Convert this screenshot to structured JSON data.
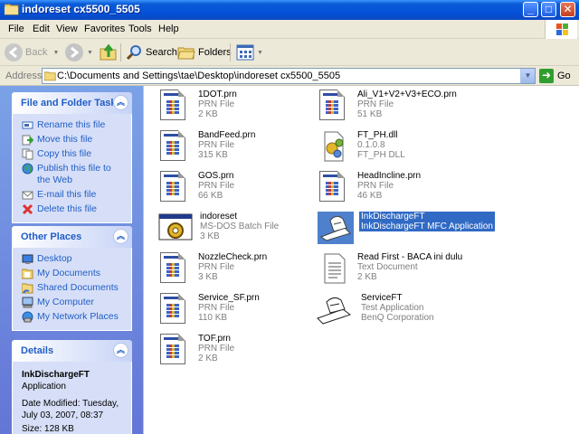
{
  "window": {
    "title": "indoreset cx5500_5505"
  },
  "menu": [
    "File",
    "Edit",
    "View",
    "Favorites",
    "Tools",
    "Help"
  ],
  "toolbar": {
    "back": "Back",
    "search": "Search",
    "folders": "Folders"
  },
  "address": {
    "label": "Address",
    "path": "C:\\Documents and Settings\\tae\\Desktop\\indoreset cx5500_5505",
    "go": "Go"
  },
  "tasks": {
    "file_folder": {
      "title": "File and Folder Tasks",
      "items": [
        "Rename this file",
        "Move this file",
        "Copy this file",
        "Publish this file to the Web",
        "E-mail this file",
        "Delete this file"
      ]
    },
    "other_places": {
      "title": "Other Places",
      "items": [
        "Desktop",
        "My Documents",
        "Shared Documents",
        "My Computer",
        "My Network Places"
      ]
    },
    "details": {
      "title": "Details",
      "name": "InkDischargeFT",
      "type": "Application",
      "modified": "Date Modified: Tuesday, July 03, 2007, 08:37",
      "size": "Size: 128 KB"
    }
  },
  "files": [
    {
      "name": "1DOT.prn",
      "line2": "PRN File",
      "line3": "2 KB",
      "icon": "prn-file-icon"
    },
    {
      "name": "Ali_V1+V2+V3+ECO.prn",
      "line2": "PRN File",
      "line3": "51 KB",
      "icon": "prn-file-icon"
    },
    {
      "name": "BandFeed.prn",
      "line2": "PRN File",
      "line3": "315 KB",
      "icon": "prn-file-icon"
    },
    {
      "name": "FT_PH.dll",
      "line2": "0.1.0.8",
      "line3": "FT_PH DLL",
      "icon": "dll-file-icon"
    },
    {
      "name": "GOS.prn",
      "line2": "PRN File",
      "line3": "66 KB",
      "icon": "prn-file-icon"
    },
    {
      "name": "HeadIncline.prn",
      "line2": "PRN File",
      "line3": "46 KB",
      "icon": "prn-file-icon"
    },
    {
      "name": "indoreset",
      "line2": "MS-DOS Batch File",
      "line3": "3 KB",
      "icon": "batch-file-icon"
    },
    {
      "name": "InkDischargeFT",
      "line2": "InkDischargeFT MFC Application",
      "line3": "",
      "icon": "ink-app-icon",
      "selected": true
    },
    {
      "name": "NozzleCheck.prn",
      "line2": "PRN File",
      "line3": "3 KB",
      "icon": "prn-file-icon"
    },
    {
      "name": "Read First - BACA ini dulu",
      "line2": "Text Document",
      "line3": "2 KB",
      "icon": "text-file-icon"
    },
    {
      "name": "Service_SF.prn",
      "line2": "PRN File",
      "line3": "110 KB",
      "icon": "prn-file-icon"
    },
    {
      "name": "ServiceFT",
      "line2": "Test Application",
      "line3": "BenQ Corporation",
      "icon": "service-app-icon"
    },
    {
      "name": "TOF.prn",
      "line2": "PRN File",
      "line3": "2 KB",
      "icon": "prn-file-icon"
    }
  ]
}
